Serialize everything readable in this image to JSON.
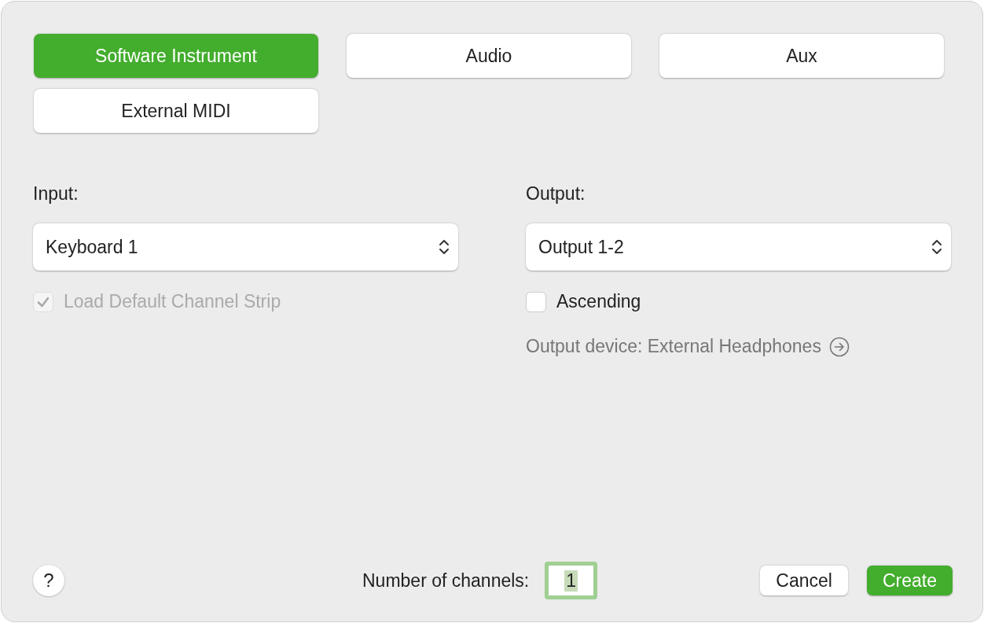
{
  "track_types": [
    {
      "label": "Software Instrument",
      "selected": true
    },
    {
      "label": "Audio",
      "selected": false
    },
    {
      "label": "Aux",
      "selected": false
    },
    {
      "label": "External MIDI",
      "selected": false
    }
  ],
  "input": {
    "label": "Input:",
    "value": "Keyboard 1",
    "options": [
      {
        "label": "Load Default Channel Strip",
        "checked": true,
        "disabled": true
      }
    ]
  },
  "output": {
    "label": "Output:",
    "value": "Output 1-2",
    "options": [
      {
        "label": "Ascending",
        "checked": false,
        "disabled": false
      }
    ],
    "device_link": "Output device: External Headphones"
  },
  "help_button": "?",
  "channels": {
    "label": "Number of channels:",
    "value": "1",
    "focused": true
  },
  "buttons": [
    {
      "label": "Cancel",
      "kind": "secondary"
    },
    {
      "label": "Create",
      "kind": "primary"
    }
  ]
}
